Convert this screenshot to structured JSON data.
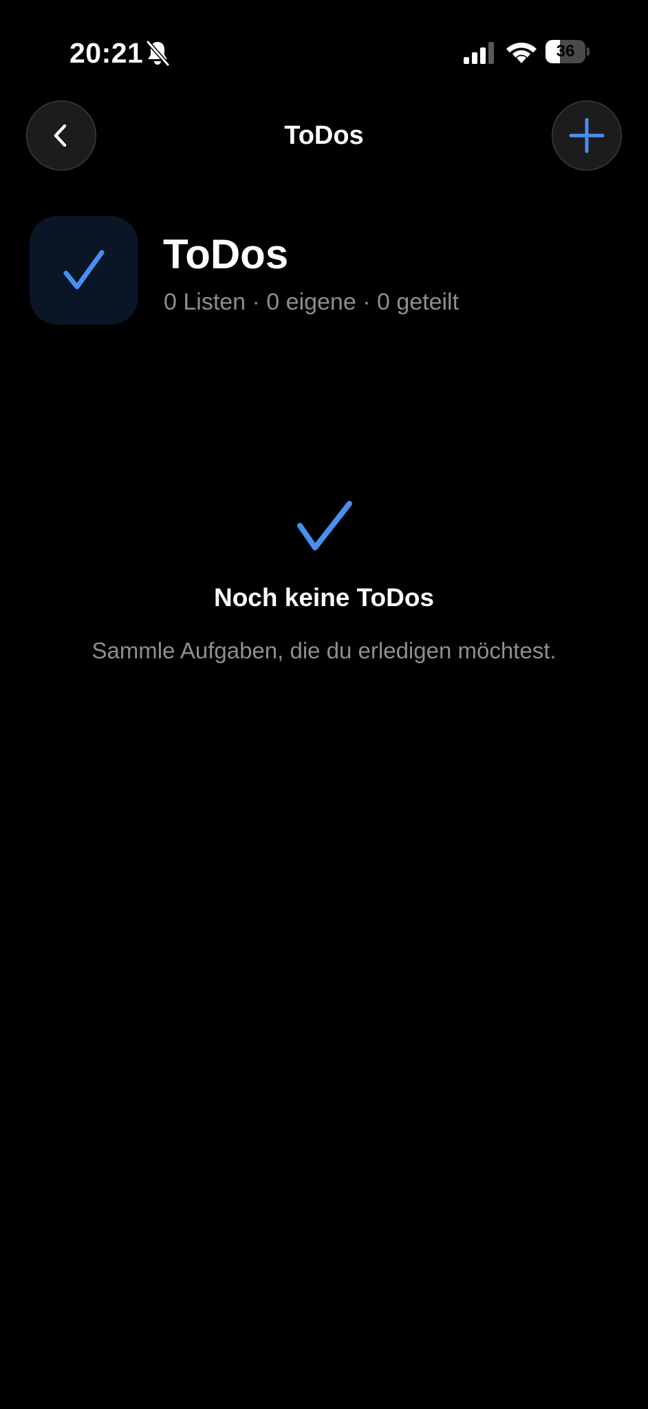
{
  "status_bar": {
    "time": "20:21",
    "battery_level": "36",
    "battery_fraction": 0.36,
    "icons": [
      "bell-slash-icon",
      "cellular-signal-icon",
      "wifi-icon",
      "battery-icon"
    ]
  },
  "nav": {
    "title": "ToDos",
    "back_icon": "chevron-left-icon",
    "add_icon": "plus-icon"
  },
  "header": {
    "icon": "checkmark-icon",
    "title": "ToDos",
    "subtitle": "0 Listen · 0 eigene · 0 geteilt"
  },
  "empty_state": {
    "icon": "checkmark-icon",
    "title": "Noch keine ToDos",
    "text": "Sammle Aufgaben, die du erledigen möchtest."
  },
  "colors": {
    "background": "#000000",
    "accent": "#4a8ff0",
    "secondary_text": "#8e8e93",
    "button_background": "#1c1c1e",
    "icon_tile_background": "#0a1626"
  }
}
